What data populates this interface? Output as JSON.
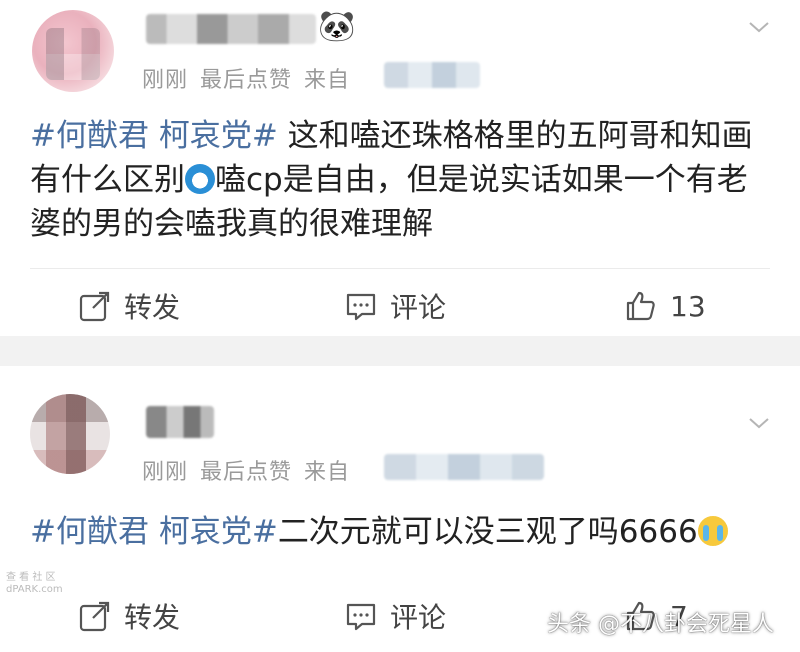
{
  "posts": [
    {
      "time": "刚刚",
      "status": "最后点赞",
      "source_label": "来自",
      "topic": "#何猷君 柯哀党#",
      "text_part1": " 这和嗑还珠格格里的五阿哥和知画有什么区别",
      "text_part2": "嗑cp是自由，但是说实话如果一个有老婆的男的会嗑我真的很难理解",
      "emoji_icon": "doraemon-emoji-icon",
      "repost_label": "转发",
      "comment_label": "评论",
      "like_count": "13"
    },
    {
      "time": "刚刚",
      "status": "最后点赞",
      "source_label": "来自",
      "topic": "#何猷君 柯哀党#",
      "text_part1": "二次元就可以没三观了吗6666",
      "emoji_icon": "crying-emoji-icon",
      "repost_label": "转发",
      "comment_label": "评论",
      "like_count": "7"
    }
  ],
  "watermark": {
    "left_line1": "查 看 社 区",
    "left_line2": "dPARK.com",
    "right": "头条 @不八卦会死星人"
  },
  "colors": {
    "topic": "#4a6fa0",
    "meta": "#9a9a9a",
    "separator": "#f2f2f2"
  }
}
